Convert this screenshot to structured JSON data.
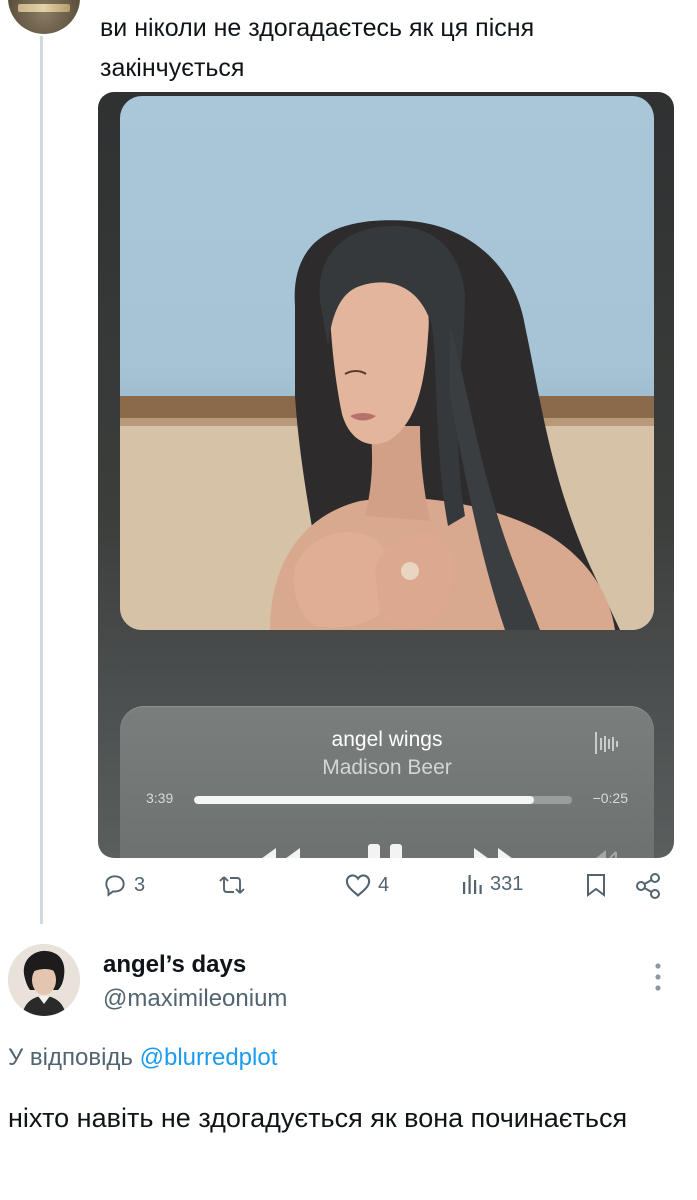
{
  "thread": {
    "tweet_text": "ви ніколи не здогадаєтесь як ця пісня закінчується"
  },
  "player": {
    "song_title": "angel wings",
    "artist": "Madison Beer",
    "elapsed": "3:39",
    "remaining": "−0:25",
    "progress": 0.9
  },
  "actions": {
    "replies": "3",
    "retweets": "",
    "likes": "4",
    "views": "331"
  },
  "reply": {
    "display_name": "angel’s days",
    "handle": "@maximileonium",
    "reply_prefix": "У відповідь",
    "reply_to_handle": "@blurredplot",
    "text": "ніхто навіть не здогадується як вона починається"
  },
  "icons": {
    "reply": "comment-icon",
    "retweet": "retweet-icon",
    "like": "heart-icon",
    "views": "views-chart-icon",
    "bookmark": "bookmark-icon",
    "share": "share-icon",
    "more": "more-vertical-icon"
  },
  "colors": {
    "text_primary": "#0f1419",
    "text_secondary": "#536471",
    "link": "#1d9bf0",
    "thread_line": "#cfd9de"
  }
}
